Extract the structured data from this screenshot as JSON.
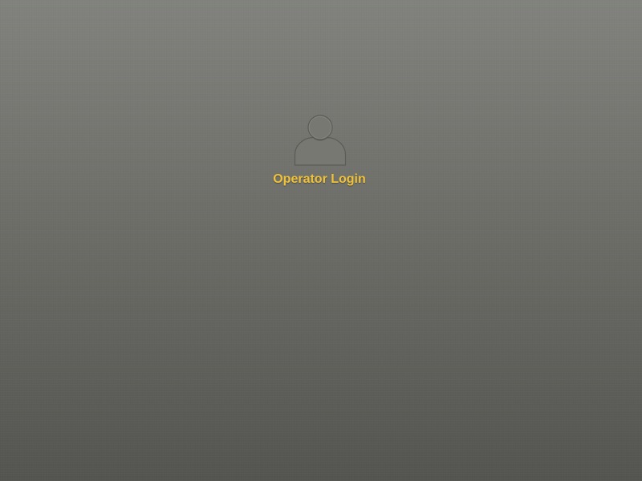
{
  "login": {
    "user_label": "Operator Login",
    "avatar_icon": "user-silhouette-icon"
  },
  "colors": {
    "label": "#f0c23a",
    "background_top": "#81827d",
    "background_bottom": "#545450",
    "avatar_fill": "#777872",
    "avatar_stroke": "#5b5c57"
  }
}
